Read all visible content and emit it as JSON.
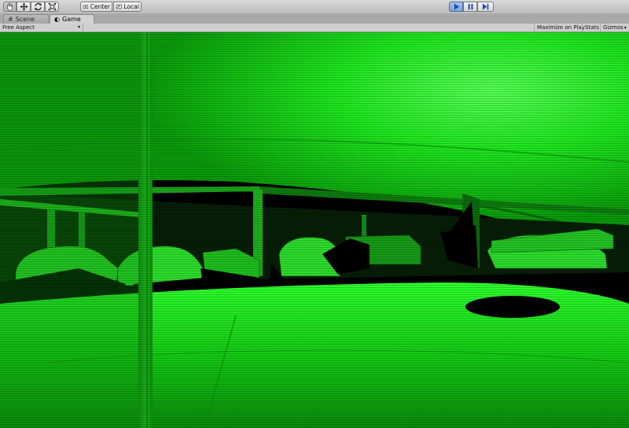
{
  "toolbar": {
    "transform_tools": [
      {
        "name": "hand-tool",
        "icon": "hand-icon",
        "active": true
      },
      {
        "name": "move-tool",
        "icon": "move-arrows-icon",
        "active": false
      },
      {
        "name": "rotate-tool",
        "icon": "rotate-icon",
        "active": false
      },
      {
        "name": "scale-tool",
        "icon": "scale-icon",
        "active": false
      }
    ],
    "pivot_mode_label": "Center",
    "pivot_rotation_label": "Local",
    "playback": {
      "play_icon": "play-icon",
      "pause_icon": "pause-icon",
      "step_icon": "step-icon",
      "playing": true
    }
  },
  "tabs": [
    {
      "label": "Scene",
      "icon": "scene-grid-icon",
      "active": false
    },
    {
      "label": "Game",
      "icon": "game-controller-icon",
      "active": true
    }
  ],
  "game_view": {
    "aspect_label": "Free Aspect",
    "maximize_label": "Maximize on Play",
    "stats_label": "Stats",
    "gizmos_label": "Gizmos"
  },
  "colors": {
    "point_cloud": "#00ff00",
    "shadow": "#000000",
    "play_active": "#8fb3e3"
  }
}
